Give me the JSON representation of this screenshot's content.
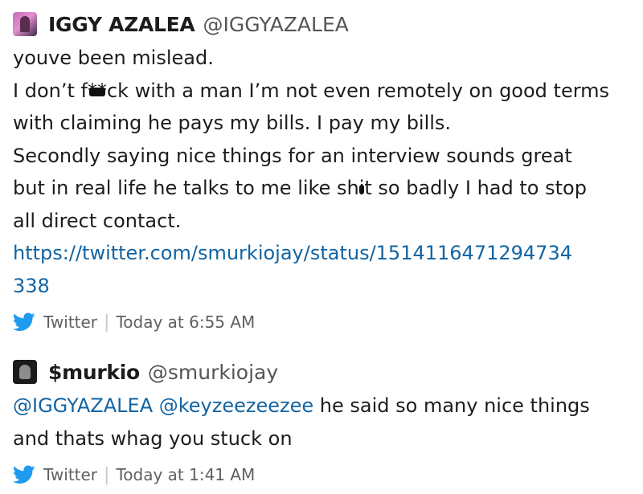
{
  "tweet1": {
    "author_name": "IGGY AZALEA",
    "author_handle": "@IGGYAZALEA",
    "lines": [
      "youve been mislead.",
      "I don’t f",
      "ck with a man I’m not even remotely on good terms",
      "with claiming he pays my bills. I pay my bills.",
      "Secondly saying nice things for an interview sounds great",
      "but in real life he talks to me like sh",
      "t so badly I had to stop",
      "all direct contact."
    ],
    "redacted_1": "**",
    "redacted_2": "i",
    "link_line1": "https://twitter.com/smurkiojay/status/1514116471294734",
    "link_line2": "338",
    "source": "Twitter",
    "time": "Today at 6:55 AM"
  },
  "tweet2": {
    "author_name": "$murkio",
    "author_handle": "@smurkiojay",
    "mention1": "@IGGYAZALEA",
    "mention2": "@keyzeezeezee",
    "text_rest": " he said so many nice things",
    "line2": "and thats whag you stuck on",
    "source": "Twitter",
    "time": "Today at 1:41 AM"
  },
  "colors": {
    "link": "#1264a3",
    "twitter_blue": "#1d9bf0",
    "text": "#1d1c1d",
    "meta": "#616061"
  },
  "icons": {
    "source": "twitter-bird-icon"
  }
}
